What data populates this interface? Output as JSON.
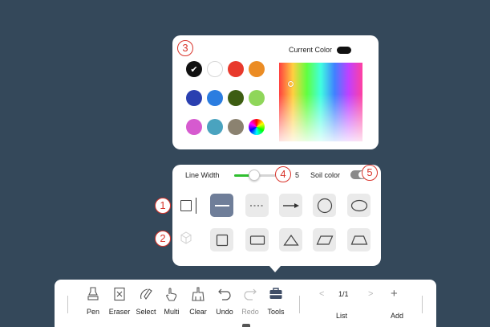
{
  "color_panel": {
    "marker": "3",
    "current_color_label": "Current Color",
    "current_color": "#111111",
    "swatches": [
      {
        "color": "#111111",
        "selected": true,
        "icon": "check-icon"
      },
      {
        "color": "#ffffff"
      },
      {
        "color": "#e8392c"
      },
      {
        "color": "#eb8c24"
      },
      {
        "color": "#2a3fb0"
      },
      {
        "color": "#2b7de0"
      },
      {
        "color": "#3d5d12"
      },
      {
        "color": "#8fd65a"
      },
      {
        "color": "#d65acf"
      },
      {
        "color": "#4aa3bf"
      },
      {
        "color": "#8b8270"
      },
      {
        "color": "rainbow",
        "icon": "color-wheel-icon"
      }
    ]
  },
  "shape_panel": {
    "line_width_label": "Line Width",
    "line_width_value": "5",
    "line_width_level": 0.45,
    "soil_color_label": "Soil color",
    "soil_color_on": true,
    "markers": {
      "line_width": "4",
      "soil_color": "5",
      "line_row": "1",
      "shape_row": "2"
    },
    "line_tools": [
      {
        "name": "solid-line-tool",
        "icon": "solid-line-icon",
        "active": true
      },
      {
        "name": "dotted-line-tool",
        "icon": "dotted-line-icon",
        "active": false
      },
      {
        "name": "arrow-line-tool",
        "icon": "arrow-icon",
        "active": false
      },
      {
        "name": "circle-tool",
        "icon": "circle-icon",
        "active": false
      },
      {
        "name": "ellipse-tool",
        "icon": "ellipse-icon",
        "active": false
      }
    ],
    "shape_tools": [
      {
        "name": "square-tool",
        "icon": "square-icon"
      },
      {
        "name": "rectangle-tool",
        "icon": "rectangle-icon"
      },
      {
        "name": "triangle-tool",
        "icon": "triangle-icon"
      },
      {
        "name": "parallelogram-tool",
        "icon": "parallelogram-icon"
      },
      {
        "name": "trapezoid-tool",
        "icon": "trapezoid-icon"
      }
    ]
  },
  "toolbar": {
    "items": [
      {
        "label": "Pen",
        "icon": "pen-icon"
      },
      {
        "label": "Eraser",
        "icon": "eraser-icon"
      },
      {
        "label": "Select",
        "icon": "select-icon"
      },
      {
        "label": "Multi",
        "icon": "multi-touch-icon"
      },
      {
        "label": "Clear",
        "icon": "clear-icon"
      },
      {
        "label": "Undo",
        "icon": "undo-icon"
      },
      {
        "label": "Redo",
        "icon": "redo-icon"
      },
      {
        "label": "Tools",
        "icon": "toolbox-icon"
      }
    ],
    "prev_glyph": "<",
    "next_glyph": ">",
    "page_indicator": "1/1",
    "list_label": "List",
    "add_glyph": "+",
    "add_label": "Add"
  }
}
